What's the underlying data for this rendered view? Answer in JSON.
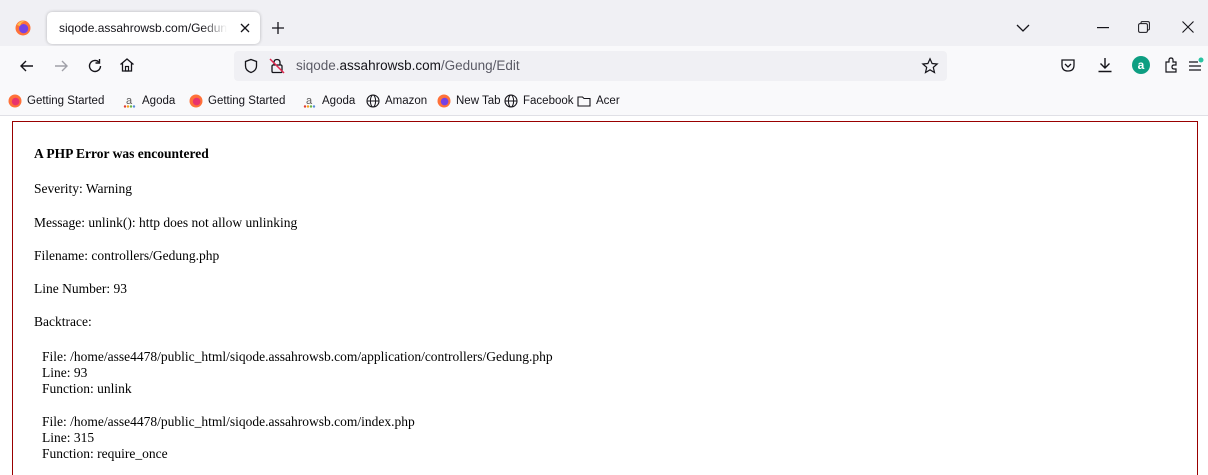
{
  "browser": {
    "tab": {
      "title": "siqode.assahrowsb.com/Gedung/Edit"
    },
    "url": {
      "prefix": "siqode.",
      "host": "assahrowsb.com",
      "path": "/Gedung/Edit"
    },
    "extension_badge": "a"
  },
  "bookmarks": [
    {
      "label": "Getting Started",
      "icon": "firefox-icon"
    },
    {
      "label": "Agoda",
      "icon": "agoda-icon"
    },
    {
      "label": "Getting Started",
      "icon": "firefox-icon"
    },
    {
      "label": "Agoda",
      "icon": "agoda-icon"
    },
    {
      "label": "Amazon",
      "icon": "globe-icon"
    },
    {
      "label": "New Tab",
      "icon": "firefox-icon"
    },
    {
      "label": "Facebook",
      "icon": "globe-icon"
    },
    {
      "label": "Acer",
      "icon": "folder-icon"
    }
  ],
  "error": {
    "heading": "A PHP Error was encountered",
    "severity": "Severity: Warning",
    "message": "Message: unlink(): http does not allow unlinking",
    "filename": "Filename: controllers/Gedung.php",
    "line_number": "Line Number: 93",
    "backtrace_label": "Backtrace:",
    "backtrace": [
      {
        "file": "File: /home/asse4478/public_html/siqode.assahrowsb.com/application/controllers/Gedung.php",
        "line": "Line: 93",
        "function": "Function: unlink"
      },
      {
        "file": "File: /home/asse4478/public_html/siqode.assahrowsb.com/index.php",
        "line": "Line: 315",
        "function": "Function: require_once"
      }
    ]
  },
  "colors": {
    "error_border": "#990000",
    "tabstrip": "#f0f0f4",
    "toolbar": "#f9f9fb"
  }
}
